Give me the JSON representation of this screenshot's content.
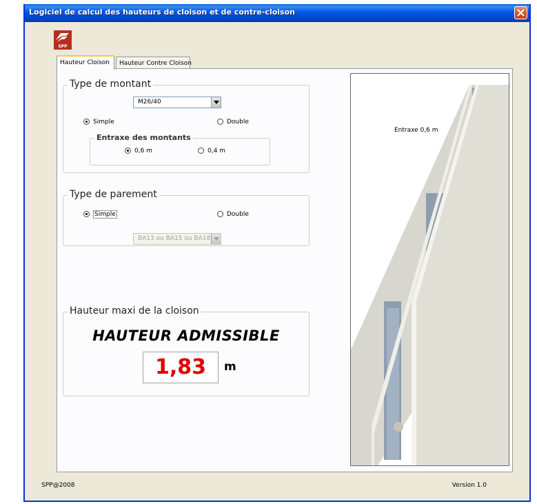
{
  "window": {
    "title": "Logiciel de calcul des hauteurs de cloison et de contre-cloison",
    "logo_text": "SPP"
  },
  "tabs": [
    {
      "label": "Hauteur Cloison",
      "active": true
    },
    {
      "label": "Hauteur Contre Cloison",
      "active": false
    }
  ],
  "type_montant": {
    "legend": "Type de montant",
    "select_value": "M26/40",
    "radio_simple": "Simple",
    "radio_double": "Double",
    "selected": "Simple",
    "entraxe": {
      "legend": "Entraxe des montants",
      "option1": "0,6 m",
      "option2": "0,4 m",
      "selected": "0,6 m"
    }
  },
  "type_parement": {
    "legend": "Type de parement",
    "radio_simple": "Simple",
    "radio_double": "Double",
    "selected": "Simple",
    "select_value": "BA13 ou BA15 ou BA18",
    "select_disabled": true
  },
  "hauteur": {
    "legend": "Hauteur maxi de la cloison",
    "heading": "HAUTEUR ADMISSIBLE",
    "value": "1,83",
    "unit": "m"
  },
  "preview": {
    "label": "Entraxe 0,6 m"
  },
  "footer": {
    "copyright": "SPP@2008",
    "version": "Version 1.0"
  },
  "colors": {
    "titlebar": "#0058e6",
    "result_value": "#e00000",
    "logo": "#b5301c"
  }
}
